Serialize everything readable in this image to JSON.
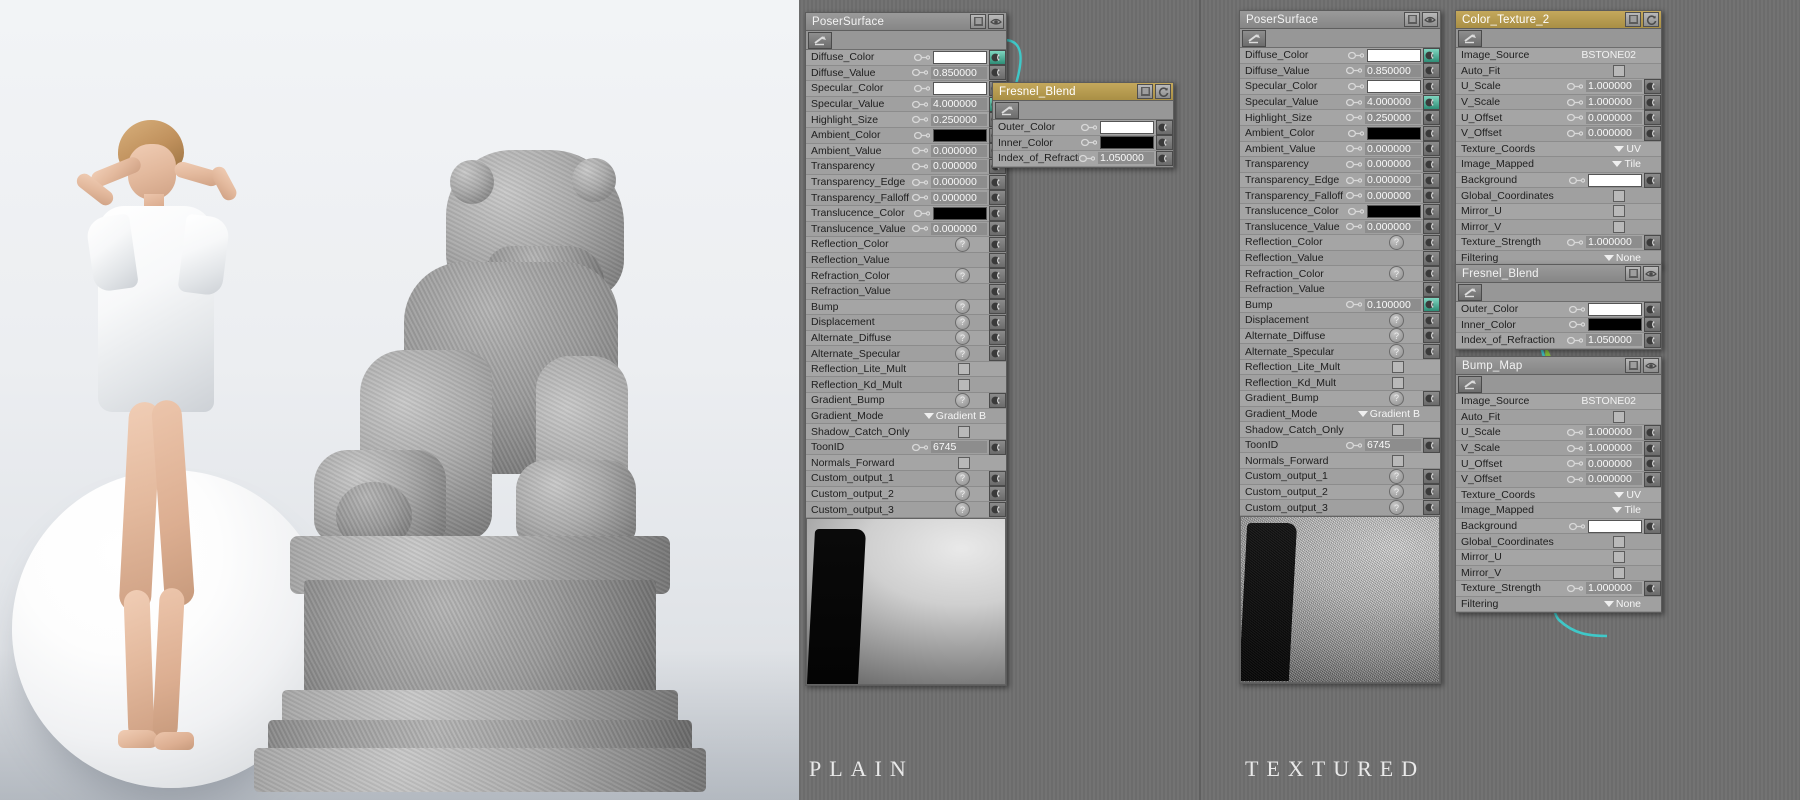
{
  "viewport": {
    "name": "render-preview",
    "captions": [
      {
        "id": "plain",
        "text": "PLAIN"
      },
      {
        "id": "textured",
        "text": "TEXTURED"
      }
    ]
  },
  "icons": {
    "list": "list-icon",
    "eye": "eye-icon",
    "refresh": "refresh-icon",
    "plug": "output-plug-icon",
    "key": "animation-key-icon",
    "question": "empty-input-icon"
  },
  "colors": {
    "node_header": "#868686",
    "node_header_selected": "#a98f45",
    "node_body": "#a5a5a5",
    "wire_cyan": "#3fc8c8",
    "wire_green": "#8cc63f",
    "wire_purple": "#7d3fc8",
    "graph_background": "#707070"
  },
  "nodes": [
    {
      "id": "poser-surface-plain",
      "title": "PoserSurface",
      "selected": false,
      "has_preview": true,
      "preview_style": "plain",
      "rows": [
        {
          "label": "Diffuse_Color",
          "kind": "swatch",
          "value": "#ffffff",
          "key": true,
          "plug": "lit"
        },
        {
          "label": "Diffuse_Value",
          "kind": "number",
          "value": "0.850000",
          "key": true,
          "plug": "normal"
        },
        {
          "label": "Specular_Color",
          "kind": "swatch",
          "value": "#ffffff",
          "key": true,
          "plug": "normal"
        },
        {
          "label": "Specular_Value",
          "kind": "number",
          "value": "4.000000",
          "key": true,
          "plug": "lit"
        },
        {
          "label": "Highlight_Size",
          "kind": "number",
          "value": "0.250000",
          "key": true,
          "plug": "normal"
        },
        {
          "label": "Ambient_Color",
          "kind": "swatch",
          "value": "#000000",
          "key": true,
          "plug": "normal"
        },
        {
          "label": "Ambient_Value",
          "kind": "number",
          "value": "0.000000",
          "key": true,
          "plug": "normal"
        },
        {
          "label": "Transparency",
          "kind": "number",
          "value": "0.000000",
          "key": true,
          "plug": "normal"
        },
        {
          "label": "Transparency_Edge",
          "kind": "number",
          "value": "0.000000",
          "key": true,
          "plug": "normal"
        },
        {
          "label": "Transparency_Falloff",
          "kind": "number",
          "value": "0.000000",
          "key": true,
          "plug": "normal"
        },
        {
          "label": "Translucence_Color",
          "kind": "swatch",
          "value": "#000000",
          "key": true,
          "plug": "normal"
        },
        {
          "label": "Translucence_Value",
          "kind": "number",
          "value": "0.000000",
          "key": true,
          "plug": "normal"
        },
        {
          "label": "Reflection_Color",
          "kind": "question",
          "value": "?",
          "key": false,
          "plug": "normal"
        },
        {
          "label": "Reflection_Value",
          "kind": "blank",
          "value": "",
          "key": false,
          "plug": "normal"
        },
        {
          "label": "Refraction_Color",
          "kind": "question",
          "value": "?",
          "key": false,
          "plug": "normal"
        },
        {
          "label": "Refraction_Value",
          "kind": "blank",
          "value": "",
          "key": false,
          "plug": "normal"
        },
        {
          "label": "Bump",
          "kind": "question",
          "value": "?",
          "key": false,
          "plug": "normal"
        },
        {
          "label": "Displacement",
          "kind": "question",
          "value": "?",
          "key": false,
          "plug": "normal"
        },
        {
          "label": "Alternate_Diffuse",
          "kind": "question",
          "value": "?",
          "key": false,
          "plug": "normal"
        },
        {
          "label": "Alternate_Specular",
          "kind": "question",
          "value": "?",
          "key": false,
          "plug": "normal"
        },
        {
          "label": "Reflection_Lite_Mult",
          "kind": "checkbox",
          "value": "",
          "key": false,
          "plug": "none"
        },
        {
          "label": "Reflection_Kd_Mult",
          "kind": "checkbox",
          "value": "",
          "key": false,
          "plug": "none"
        },
        {
          "label": "Gradient_Bump",
          "kind": "question",
          "value": "?",
          "key": false,
          "plug": "normal"
        },
        {
          "label": "Gradient_Mode",
          "kind": "popup",
          "value": "Gradient B",
          "key": false,
          "plug": "none"
        },
        {
          "label": "Shadow_Catch_Only",
          "kind": "checkbox",
          "value": "",
          "key": false,
          "plug": "none"
        },
        {
          "label": "ToonID",
          "kind": "number",
          "value": "6745",
          "key": true,
          "plug": "normal"
        },
        {
          "label": "Normals_Forward",
          "kind": "checkbox",
          "value": "",
          "key": false,
          "plug": "none"
        },
        {
          "label": "Custom_output_1",
          "kind": "question",
          "value": "?",
          "key": false,
          "plug": "normal"
        },
        {
          "label": "Custom_output_2",
          "kind": "question",
          "value": "?",
          "key": false,
          "plug": "normal"
        },
        {
          "label": "Custom_output_3",
          "kind": "question",
          "value": "?",
          "key": false,
          "plug": "normal"
        }
      ]
    },
    {
      "id": "fresnel-blend-plain",
      "title": "Fresnel_Blend",
      "selected": true,
      "has_preview": false,
      "rows": [
        {
          "label": "Outer_Color",
          "kind": "swatch",
          "value": "#ffffff",
          "key": true,
          "plug": "normal"
        },
        {
          "label": "Inner_Color",
          "kind": "swatch",
          "value": "#000000",
          "key": true,
          "plug": "normal"
        },
        {
          "label": "Index_of_Refraction",
          "kind": "number",
          "value": "1.050000",
          "key": true,
          "plug": "normal"
        }
      ]
    },
    {
      "id": "poser-surface-textured",
      "title": "PoserSurface",
      "selected": false,
      "has_preview": true,
      "preview_style": "textured",
      "rows": [
        {
          "label": "Diffuse_Color",
          "kind": "swatch",
          "value": "#ffffff",
          "key": true,
          "plug": "lit"
        },
        {
          "label": "Diffuse_Value",
          "kind": "number",
          "value": "0.850000",
          "key": true,
          "plug": "normal"
        },
        {
          "label": "Specular_Color",
          "kind": "swatch",
          "value": "#ffffff",
          "key": true,
          "plug": "normal"
        },
        {
          "label": "Specular_Value",
          "kind": "number",
          "value": "4.000000",
          "key": true,
          "plug": "lit"
        },
        {
          "label": "Highlight_Size",
          "kind": "number",
          "value": "0.250000",
          "key": true,
          "plug": "normal"
        },
        {
          "label": "Ambient_Color",
          "kind": "swatch",
          "value": "#000000",
          "key": true,
          "plug": "normal"
        },
        {
          "label": "Ambient_Value",
          "kind": "number",
          "value": "0.000000",
          "key": true,
          "plug": "normal"
        },
        {
          "label": "Transparency",
          "kind": "number",
          "value": "0.000000",
          "key": true,
          "plug": "normal"
        },
        {
          "label": "Transparency_Edge",
          "kind": "number",
          "value": "0.000000",
          "key": true,
          "plug": "normal"
        },
        {
          "label": "Transparency_Falloff",
          "kind": "number",
          "value": "0.000000",
          "key": true,
          "plug": "normal"
        },
        {
          "label": "Translucence_Color",
          "kind": "swatch",
          "value": "#000000",
          "key": true,
          "plug": "normal"
        },
        {
          "label": "Translucence_Value",
          "kind": "number",
          "value": "0.000000",
          "key": true,
          "plug": "normal"
        },
        {
          "label": "Reflection_Color",
          "kind": "question",
          "value": "?",
          "key": false,
          "plug": "normal"
        },
        {
          "label": "Reflection_Value",
          "kind": "blank",
          "value": "",
          "key": false,
          "plug": "normal"
        },
        {
          "label": "Refraction_Color",
          "kind": "question",
          "value": "?",
          "key": false,
          "plug": "normal"
        },
        {
          "label": "Refraction_Value",
          "kind": "blank",
          "value": "",
          "key": false,
          "plug": "normal"
        },
        {
          "label": "Bump",
          "kind": "number",
          "value": "0.100000",
          "key": true,
          "plug": "lit"
        },
        {
          "label": "Displacement",
          "kind": "question",
          "value": "?",
          "key": false,
          "plug": "normal"
        },
        {
          "label": "Alternate_Diffuse",
          "kind": "question",
          "value": "?",
          "key": false,
          "plug": "normal"
        },
        {
          "label": "Alternate_Specular",
          "kind": "question",
          "value": "?",
          "key": false,
          "plug": "normal"
        },
        {
          "label": "Reflection_Lite_Mult",
          "kind": "checkbox",
          "value": "",
          "key": false,
          "plug": "none"
        },
        {
          "label": "Reflection_Kd_Mult",
          "kind": "checkbox",
          "value": "",
          "key": false,
          "plug": "none"
        },
        {
          "label": "Gradient_Bump",
          "kind": "question",
          "value": "?",
          "key": false,
          "plug": "normal"
        },
        {
          "label": "Gradient_Mode",
          "kind": "popup",
          "value": "Gradient B",
          "key": false,
          "plug": "none"
        },
        {
          "label": "Shadow_Catch_Only",
          "kind": "checkbox",
          "value": "",
          "key": false,
          "plug": "none"
        },
        {
          "label": "ToonID",
          "kind": "number",
          "value": "6745",
          "key": true,
          "plug": "normal"
        },
        {
          "label": "Normals_Forward",
          "kind": "checkbox",
          "value": "",
          "key": false,
          "plug": "none"
        },
        {
          "label": "Custom_output_1",
          "kind": "question",
          "value": "?",
          "key": false,
          "plug": "normal"
        },
        {
          "label": "Custom_output_2",
          "kind": "question",
          "value": "?",
          "key": false,
          "plug": "normal"
        },
        {
          "label": "Custom_output_3",
          "kind": "question",
          "value": "?",
          "key": false,
          "plug": "normal"
        }
      ]
    },
    {
      "id": "color-texture-2",
      "title": "Color_Texture_2",
      "selected": true,
      "has_preview": false,
      "rows": [
        {
          "label": "Image_Source",
          "kind": "source",
          "value": "BSTONE02",
          "key": false,
          "plug": "none"
        },
        {
          "label": "Auto_Fit",
          "kind": "checkbox",
          "value": "",
          "key": false,
          "plug": "none"
        },
        {
          "label": "U_Scale",
          "kind": "number",
          "value": "1.000000",
          "key": true,
          "plug": "normal"
        },
        {
          "label": "V_Scale",
          "kind": "number",
          "value": "1.000000",
          "key": true,
          "plug": "normal"
        },
        {
          "label": "U_Offset",
          "kind": "number",
          "value": "0.000000",
          "key": true,
          "plug": "normal"
        },
        {
          "label": "V_Offset",
          "kind": "number",
          "value": "0.000000",
          "key": true,
          "plug": "normal"
        },
        {
          "label": "Texture_Coords",
          "kind": "popup",
          "value": "UV",
          "key": false,
          "plug": "none"
        },
        {
          "label": "Image_Mapped",
          "kind": "popup",
          "value": "Tile",
          "key": false,
          "plug": "none"
        },
        {
          "label": "Background",
          "kind": "swatch",
          "value": "#ffffff",
          "key": true,
          "plug": "normal"
        },
        {
          "label": "Global_Coordinates",
          "kind": "checkbox",
          "value": "",
          "key": false,
          "plug": "none"
        },
        {
          "label": "Mirror_U",
          "kind": "checkbox",
          "value": "",
          "key": false,
          "plug": "none"
        },
        {
          "label": "Mirror_V",
          "kind": "checkbox",
          "value": "",
          "key": false,
          "plug": "none"
        },
        {
          "label": "Texture_Strength",
          "kind": "number",
          "value": "1.000000",
          "key": true,
          "plug": "normal"
        },
        {
          "label": "Filtering",
          "kind": "popup",
          "value": "None",
          "key": false,
          "plug": "none"
        }
      ]
    },
    {
      "id": "fresnel-blend-textured",
      "title": "Fresnel_Blend",
      "selected": false,
      "has_preview": false,
      "rows": [
        {
          "label": "Outer_Color",
          "kind": "swatch",
          "value": "#ffffff",
          "key": true,
          "plug": "normal"
        },
        {
          "label": "Inner_Color",
          "kind": "swatch",
          "value": "#000000",
          "key": true,
          "plug": "normal"
        },
        {
          "label": "Index_of_Refraction",
          "kind": "number",
          "value": "1.050000",
          "key": true,
          "plug": "normal"
        }
      ]
    },
    {
      "id": "bump-map",
      "title": "Bump_Map",
      "selected": false,
      "has_preview": false,
      "rows": [
        {
          "label": "Image_Source",
          "kind": "source",
          "value": "BSTONE02",
          "key": false,
          "plug": "none"
        },
        {
          "label": "Auto_Fit",
          "kind": "checkbox",
          "value": "",
          "key": false,
          "plug": "none"
        },
        {
          "label": "U_Scale",
          "kind": "number",
          "value": "1.000000",
          "key": true,
          "plug": "normal"
        },
        {
          "label": "V_Scale",
          "kind": "number",
          "value": "1.000000",
          "key": true,
          "plug": "normal"
        },
        {
          "label": "U_Offset",
          "kind": "number",
          "value": "0.000000",
          "key": true,
          "plug": "normal"
        },
        {
          "label": "V_Offset",
          "kind": "number",
          "value": "0.000000",
          "key": true,
          "plug": "normal"
        },
        {
          "label": "Texture_Coords",
          "kind": "popup",
          "value": "UV",
          "key": false,
          "plug": "none"
        },
        {
          "label": "Image_Mapped",
          "kind": "popup",
          "value": "Tile",
          "key": false,
          "plug": "none"
        },
        {
          "label": "Background",
          "kind": "swatch",
          "value": "#ffffff",
          "key": true,
          "plug": "normal"
        },
        {
          "label": "Global_Coordinates",
          "kind": "checkbox",
          "value": "",
          "key": false,
          "plug": "none"
        },
        {
          "label": "Mirror_U",
          "kind": "checkbox",
          "value": "",
          "key": false,
          "plug": "none"
        },
        {
          "label": "Mirror_V",
          "kind": "checkbox",
          "value": "",
          "key": false,
          "plug": "none"
        },
        {
          "label": "Texture_Strength",
          "kind": "number",
          "value": "1.000000",
          "key": true,
          "plug": "normal"
        },
        {
          "label": "Filtering",
          "kind": "popup",
          "value": "None",
          "key": false,
          "plug": "none"
        }
      ]
    }
  ]
}
